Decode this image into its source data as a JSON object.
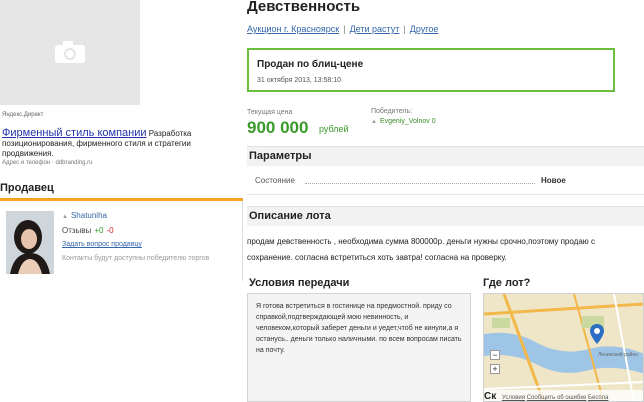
{
  "ad": {
    "label": "Яндекс.Директ",
    "title": "Фирменный стиль компании",
    "text": " Разработка позиционирования, фирменного стиля и стратегии продвижения.",
    "phone": "Адрес и телефон · ddbranding.ru"
  },
  "seller": {
    "heading": "Продавец",
    "name": "Shatuniha",
    "reviews_label": "Отзывы",
    "reviews_positive": "+0",
    "reviews_negative": "-0",
    "ask_link": "Задать вопрос продавцу",
    "contacts_note": "Контакты будут доступны победителю торгов"
  },
  "lot": {
    "title": "Девственность",
    "breadcrumb": [
      "Аукцион г. Красноярск",
      "Дети растут",
      "Другое"
    ],
    "sold_title": "Продан по блиц-цене",
    "sold_date": "31 октября 2013, 13:58:10",
    "price_label": "Текущая цена",
    "price_value": "900 000",
    "price_unit": "рублей",
    "winner_label": "Победитель:",
    "winner_name": "Evgeniy_Volnov",
    "winner_score": "0"
  },
  "params": {
    "heading": "Параметры",
    "rows": [
      {
        "name": "Состояние",
        "value": "Новое"
      }
    ]
  },
  "description": {
    "heading": "Описание лота",
    "line1": "продам девственность , необходима сумма 800000р. деньги нужны срочно,поэтому продаю с",
    "line2": "сохранение. согласна встретиться хоть завтра! согласна на проверку."
  },
  "conditions": {
    "heading": "Условия передачи",
    "text": "Я готова встретиться в гостинице на предмостной. приду со справкой,подтверждающей мою невинность, и человеком,который заберет деньги и уедет,чтоб не кинули,а я останусь.. деньги только наличными. по всем вопросам писать на почту."
  },
  "map": {
    "heading": "Где лот?",
    "zoom_out": "−",
    "zoom_in": "+",
    "brand": "Ск",
    "links": [
      "Условия",
      "Сообщить об ошибке",
      "Беспла"
    ],
    "town": "Ленинский район"
  },
  "colors": {
    "accent_green": "#6cbf3e",
    "price_green": "#3a9a2a",
    "seller_bar": "#f4a623",
    "link_blue": "#3366aa"
  }
}
